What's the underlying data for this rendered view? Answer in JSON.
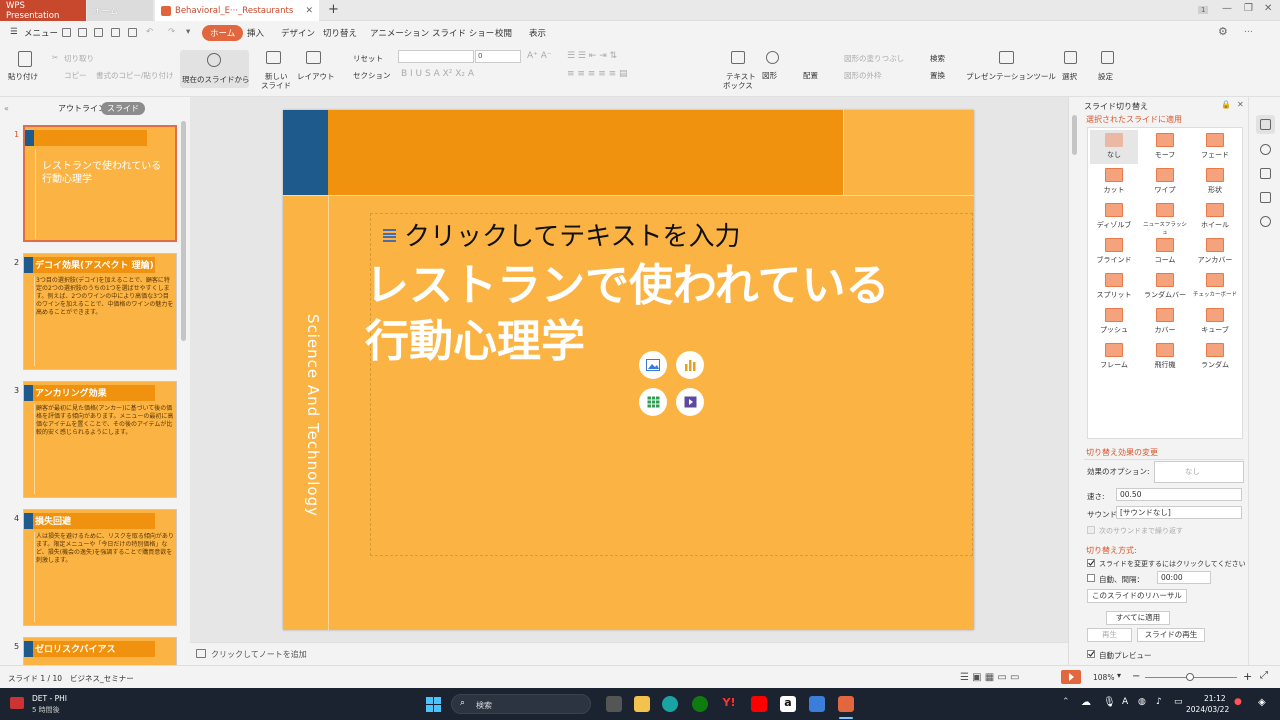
{
  "titlebar": {
    "app_tab": "WPS Presentation",
    "home_tab": "ホーム",
    "doc_tab": "Behavioral_E···_Restaurants",
    "badge": "1"
  },
  "menu": {
    "menu_label": "メニュー",
    "items": [
      "ホーム",
      "挿入",
      "デザイン",
      "切り替え",
      "アニメーション",
      "スライド ショー",
      "校閲",
      "表示"
    ]
  },
  "ribbon": {
    "paste": "貼り付け",
    "cut": "切り取り",
    "copy": "コピー",
    "format_painter": "書式のコピー/貼り付け",
    "from_current": "現在のスライドから",
    "new_slide_1": "新しい",
    "new_slide_2": "スライド",
    "layout": "レイアウト",
    "reset": "リセット",
    "section": "セクション",
    "font_size": "0",
    "textbox_1": "テキスト",
    "textbox_2": "ボックス",
    "shape": "図形",
    "arrange": "配置",
    "shape_fill": "図形の塗りつぶし",
    "shape_outline": "図形の外枠",
    "search": "検索",
    "replace": "置換",
    "presentation_tools": "プレゼンテーションツール",
    "select": "選択",
    "settings": "設定"
  },
  "left_panel": {
    "outline_tab": "アウトライン",
    "slide_tab": "スライド",
    "slides": [
      {
        "num": "1",
        "title": "",
        "body": "レストランで使われている\n行動心理学"
      },
      {
        "num": "2",
        "title": "デコイ効果(アスペクト 理論)",
        "body": "3つ目の選択肢(デコイ)を加えることで、顧客に特定の2つの選択肢のうちの1つを選ばせやすくします。例えば、2つのワインの中により高価な3つ目のワインを加えることで、中価格のワインの魅力を高めることができます。"
      },
      {
        "num": "3",
        "title": "アンカリング効果",
        "body": "顧客が最初に見た価格(アンカー)に基づいて後の価格を評価する傾向があります。メニューの最初に高価なアイテムを置くことで、その後のアイテムが比較的安く感じられるようにします。"
      },
      {
        "num": "4",
        "title": "損失回避",
        "body": "人は損失を避けるために、リスクを取る傾向があります。限定メニューや「今日だけの特別価格」など、損失(機会の逸失)を強調することで購買意欲を刺激します。"
      },
      {
        "num": "5",
        "title": "ゼロリスクバイアス",
        "body": ""
      }
    ]
  },
  "slide": {
    "vertical_text": "Science And Technology",
    "placeholder": "クリックしてテキストを入力",
    "title_line1": "レストランで使われている",
    "title_line2": "行動心理学"
  },
  "notes": {
    "placeholder": "クリックしてノートを追加"
  },
  "right_panel": {
    "header": "スライド切り替え",
    "apply_selected": "選択されたスライドに適用",
    "transitions": [
      "なし",
      "モーフ",
      "フェード",
      "カット",
      "ワイプ",
      "形状",
      "ディゾルブ",
      "ニュースフラッシュ",
      "ホイール",
      "ブラインド",
      "コーム",
      "アンカバー",
      "スプリット",
      "ランダムバー",
      "チェッカーボード",
      "プッシュ",
      "カバー",
      "キューブ",
      "フレーム",
      "飛行機",
      "ランダム"
    ],
    "modify_heading": "切り替え効果の変更",
    "effect_options_label": "効果のオプション:",
    "effect_options_value": "なし",
    "speed_label": "速さ:",
    "speed_value": "00.50",
    "sound_label": "サウンド:",
    "sound_value": "[サウンドなし]",
    "loop_sound": "次のサウンドまで繰り返す",
    "advance_heading": "切り替え方式:",
    "on_click": "スライドを変更するにはクリックしてください",
    "auto_label": "自動、間隔：",
    "auto_value": "00:00",
    "rehearse": "このスライドのリハーサル",
    "apply_all": "すべてに適用",
    "play": "再生",
    "slideshow": "スライドの再生",
    "auto_preview": "自動プレビュー"
  },
  "statusbar": {
    "slide_info": "スライド 1 / 10",
    "theme": "ビジネス_セミナー",
    "zoom": "108%"
  },
  "taskbar": {
    "weather_temp": "DET - PHI",
    "weather_sub": "5 時間後",
    "search": "検索",
    "time": "21:12",
    "date": "2024/03/22",
    "lang": "A"
  },
  "colors": {
    "accent": "#e2673f",
    "slide_bg": "#fbb444",
    "slide_band": "#f0920e",
    "slide_blue": "#1e5a8c"
  }
}
